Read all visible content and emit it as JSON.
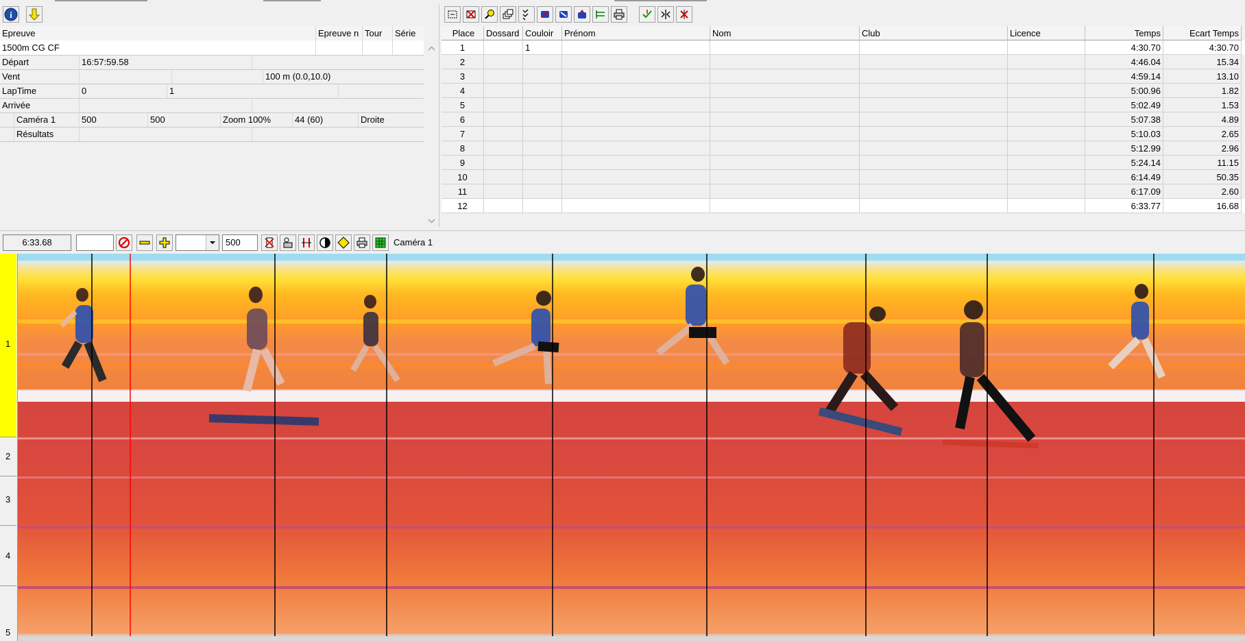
{
  "toolbar_left": {
    "icons": [
      "info-icon",
      "arrow-down-icon"
    ]
  },
  "event_grid": {
    "headers": [
      "Epreuve",
      "Epreuve n",
      "Tour",
      "Série"
    ],
    "event_name": "1500m CG CF",
    "depart": {
      "label": "Départ",
      "value": "16:57:59.58"
    },
    "vent": {
      "label": "Vent",
      "value": "100 m (0.0,10.0)"
    },
    "laptime": {
      "label": "LapTime",
      "v1": "0",
      "v2": "1"
    },
    "arrivee": {
      "label": "Arrivée"
    },
    "camera": {
      "label": "Caméra 1",
      "v1": "500",
      "v2": "500",
      "zoom": "Zoom 100%",
      "v3": "44  (60)",
      "side": "Droite"
    },
    "resultats": {
      "label": "Résultats"
    }
  },
  "toolbar_right": {
    "icons": [
      "select-all-icon",
      "delete-icon",
      "search-icon",
      "windows-icon",
      "check-list-icon",
      "import-icon",
      "export-icon",
      "upload-icon",
      "tree-icon",
      "print-icon",
      "validate-icon",
      "split-icon",
      "remove-icon"
    ]
  },
  "results_table": {
    "headers": [
      "Place",
      "Dossard",
      "Couloir",
      "Prénom",
      "Nom",
      "Club",
      "Licence",
      "Temps",
      "Ecart Temps"
    ],
    "rows": [
      {
        "place": "1",
        "dossard": "",
        "couloir": "1",
        "prenom": "",
        "nom": "",
        "club": "",
        "licence": "",
        "temps": "4:30.70",
        "ecart": "4:30.70"
      },
      {
        "place": "2",
        "dossard": "",
        "couloir": "",
        "prenom": "",
        "nom": "",
        "club": "",
        "licence": "",
        "temps": "4:46.04",
        "ecart": "15.34"
      },
      {
        "place": "3",
        "dossard": "",
        "couloir": "",
        "prenom": "",
        "nom": "",
        "club": "",
        "licence": "",
        "temps": "4:59.14",
        "ecart": "13.10"
      },
      {
        "place": "4",
        "dossard": "",
        "couloir": "",
        "prenom": "",
        "nom": "",
        "club": "",
        "licence": "",
        "temps": "5:00.96",
        "ecart": "1.82"
      },
      {
        "place": "5",
        "dossard": "",
        "couloir": "",
        "prenom": "",
        "nom": "",
        "club": "",
        "licence": "",
        "temps": "5:02.49",
        "ecart": "1.53"
      },
      {
        "place": "6",
        "dossard": "",
        "couloir": "",
        "prenom": "",
        "nom": "",
        "club": "",
        "licence": "",
        "temps": "5:07.38",
        "ecart": "4.89"
      },
      {
        "place": "7",
        "dossard": "",
        "couloir": "",
        "prenom": "",
        "nom": "",
        "club": "",
        "licence": "",
        "temps": "5:10.03",
        "ecart": "2.65"
      },
      {
        "place": "8",
        "dossard": "",
        "couloir": "",
        "prenom": "",
        "nom": "",
        "club": "",
        "licence": "",
        "temps": "5:12.99",
        "ecart": "2.96"
      },
      {
        "place": "9",
        "dossard": "",
        "couloir": "",
        "prenom": "",
        "nom": "",
        "club": "",
        "licence": "",
        "temps": "5:24.14",
        "ecart": "11.15"
      },
      {
        "place": "10",
        "dossard": "",
        "couloir": "",
        "prenom": "",
        "nom": "",
        "club": "",
        "licence": "",
        "temps": "6:14.49",
        "ecart": "50.35"
      },
      {
        "place": "11",
        "dossard": "",
        "couloir": "",
        "prenom": "",
        "nom": "",
        "club": "",
        "licence": "",
        "temps": "6:17.09",
        "ecart": "2.60"
      },
      {
        "place": "12",
        "dossard": "",
        "couloir": "",
        "prenom": "",
        "nom": "",
        "club": "",
        "licence": "",
        "temps": "6:33.77",
        "ecart": "16.68"
      }
    ]
  },
  "photo_toolbar": {
    "time": "6:33.68",
    "input_value": "",
    "dropdown_value": "",
    "scan_value": "500",
    "camera_label": "Caméra 1",
    "icons": [
      "cancel-icon",
      "zoom-out-icon",
      "zoom-in-icon",
      "clear-icon",
      "reader-icon",
      "split-lines-icon",
      "contrast-icon",
      "diamond-icon",
      "print-icon",
      "grid-icon"
    ]
  },
  "lanes": [
    "1",
    "2",
    "3",
    "4",
    "5"
  ],
  "colors": {
    "accent": "#1f4fa8",
    "lane_selected": "#ffff00",
    "cursor_line": "#ff0000"
  }
}
